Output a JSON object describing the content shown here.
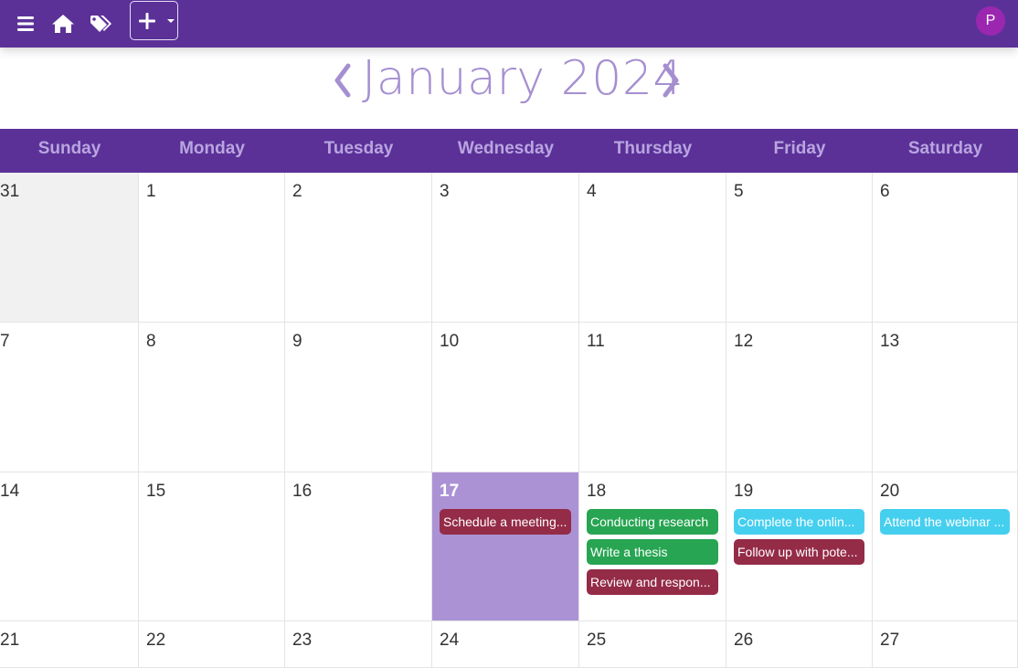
{
  "toolbar": {
    "menu_icon": "hamburger-menu-icon",
    "home_icon": "home-icon",
    "tags_icon": "tags-icon",
    "add_icon": "plus-icon",
    "avatar_initial": "P"
  },
  "calendar": {
    "title": "January 2024",
    "prev_icon": "chevron-left-icon",
    "next_icon": "chevron-right-icon",
    "weekdays": [
      "Sunday",
      "Monday",
      "Tuesday",
      "Wednesday",
      "Thursday",
      "Friday",
      "Saturday"
    ],
    "weeks": [
      [
        {
          "day": "31",
          "other": true,
          "events": []
        },
        {
          "day": "1",
          "events": []
        },
        {
          "day": "2",
          "events": []
        },
        {
          "day": "3",
          "events": []
        },
        {
          "day": "4",
          "events": []
        },
        {
          "day": "5",
          "events": []
        },
        {
          "day": "6",
          "events": []
        }
      ],
      [
        {
          "day": "7",
          "events": []
        },
        {
          "day": "8",
          "events": []
        },
        {
          "day": "9",
          "events": []
        },
        {
          "day": "10",
          "events": []
        },
        {
          "day": "11",
          "events": []
        },
        {
          "day": "12",
          "events": []
        },
        {
          "day": "13",
          "events": []
        }
      ],
      [
        {
          "day": "14",
          "events": []
        },
        {
          "day": "15",
          "events": []
        },
        {
          "day": "16",
          "events": []
        },
        {
          "day": "17",
          "today": true,
          "events": [
            {
              "label": "Schedule a meeting...",
              "color": "#942b47"
            }
          ]
        },
        {
          "day": "18",
          "events": [
            {
              "label": "Conducting research",
              "color": "#27a552"
            },
            {
              "label": "Write a thesis",
              "color": "#27a552"
            },
            {
              "label": "Review and respon...",
              "color": "#942b47"
            }
          ]
        },
        {
          "day": "19",
          "events": [
            {
              "label": "Complete the onlin...",
              "color": "#45cfef"
            },
            {
              "label": "Follow up with pote...",
              "color": "#942b47"
            }
          ]
        },
        {
          "day": "20",
          "events": [
            {
              "label": "Attend the webinar ...",
              "color": "#45cfef"
            }
          ]
        }
      ],
      [
        {
          "day": "21",
          "events": []
        },
        {
          "day": "22",
          "events": []
        },
        {
          "day": "23",
          "events": []
        },
        {
          "day": "24",
          "events": []
        },
        {
          "day": "25",
          "events": []
        },
        {
          "day": "26",
          "events": []
        },
        {
          "day": "27",
          "events": []
        }
      ]
    ]
  },
  "colors": {
    "topbar": "#5b3198",
    "weekday_text": "#b9a5e0",
    "title_text": "#a58fd0",
    "today_bg": "#ab92d5",
    "avatar_bg": "#9b27b0"
  }
}
